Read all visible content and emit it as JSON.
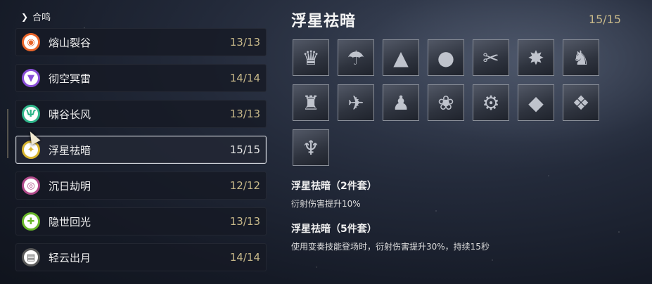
{
  "section": {
    "label": "合鸣"
  },
  "sets": [
    {
      "name": "熔山裂谷",
      "count": "13/13",
      "color": "#e8652a",
      "glyph": "◉"
    },
    {
      "name": "彻空冥雷",
      "count": "14/14",
      "color": "#8a4fd8",
      "glyph": "▼"
    },
    {
      "name": "啸谷长风",
      "count": "13/13",
      "color": "#2fb58a",
      "glyph": "Ѱ"
    },
    {
      "name": "浮星祛暗",
      "count": "15/15",
      "color": "#d8b530",
      "glyph": "✦"
    },
    {
      "name": "沉日劫明",
      "count": "12/12",
      "color": "#b04a8a",
      "glyph": "◎"
    },
    {
      "name": "隐世回光",
      "count": "13/13",
      "color": "#6ab82a",
      "glyph": "✚"
    },
    {
      "name": "轻云出月",
      "count": "14/14",
      "color": "#5a5a5a",
      "glyph": "▤"
    }
  ],
  "selected_set": {
    "title": "浮星祛暗",
    "progress": "15/15",
    "echo_icons": [
      "echo-1-icon",
      "echo-2-icon",
      "echo-3-icon",
      "echo-4-icon",
      "echo-5-icon",
      "echo-6-icon",
      "echo-7-icon",
      "echo-8-icon",
      "echo-9-icon",
      "echo-10-icon",
      "echo-11-icon",
      "echo-12-icon",
      "echo-13-icon",
      "echo-14-icon",
      "echo-15-icon"
    ],
    "effects": [
      {
        "title": "浮星祛暗（2件套）",
        "desc": "衍射伤害提升10%"
      },
      {
        "title": "浮星祛暗（5件套）",
        "desc": "使用变奏技能登场时，衍射伤害提升30%，持续15秒"
      }
    ]
  }
}
